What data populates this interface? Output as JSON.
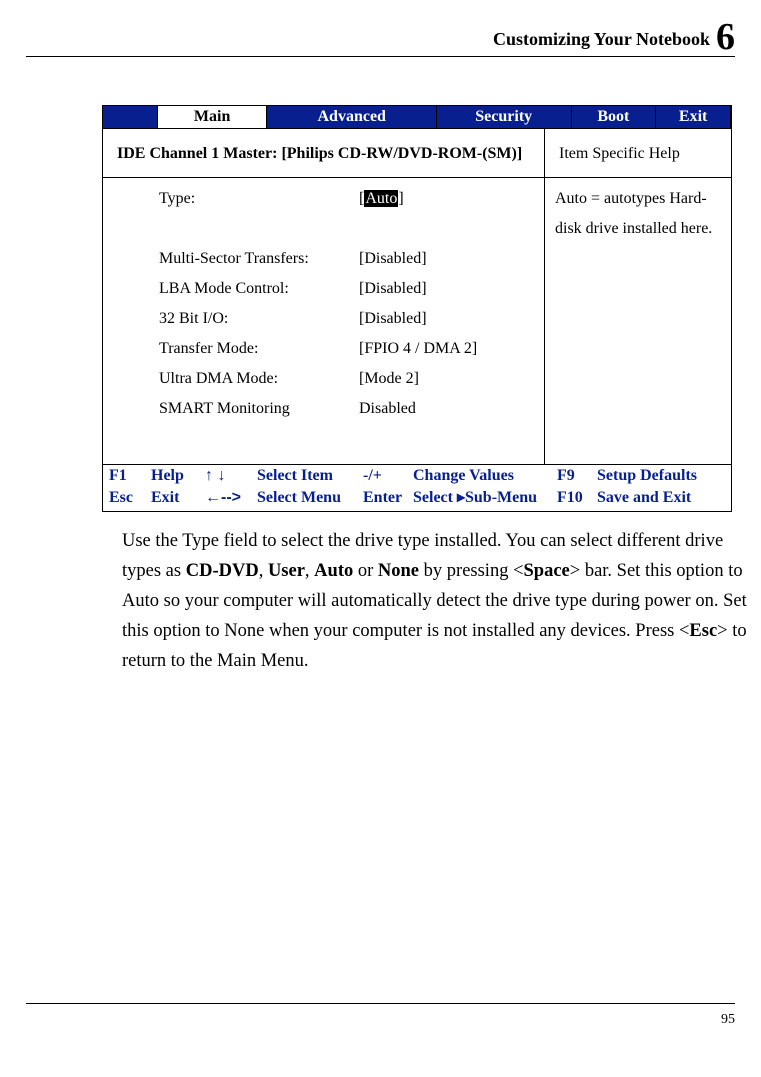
{
  "header": {
    "title": "Customizing Your Notebook",
    "chapter_number": "6"
  },
  "bios": {
    "tabs": {
      "main": "Main",
      "advanced": "Advanced",
      "security": "Security",
      "boot": "Boot",
      "exit": "Exit"
    },
    "panel_title": "IDE Channel 1 Master: [Philips CD-RW/DVD-ROM-(SM)]",
    "help_title": "Item Specific Help",
    "help_text": "Auto = autotypes Hard-disk drive installed here.",
    "settings": {
      "type": {
        "label": "Type:",
        "value": "Auto",
        "highlight": true,
        "bracket": true
      },
      "multi": {
        "label": "Multi-Sector Transfers:",
        "value": "[Disabled]",
        "highlight": false,
        "bracket": false
      },
      "lba": {
        "label": "LBA Mode Control:",
        "value": "[Disabled]",
        "highlight": false,
        "bracket": false
      },
      "bit32": {
        "label": "32 Bit I/O:",
        "value": "[Disabled]",
        "highlight": false,
        "bracket": false
      },
      "xfer": {
        "label": "Transfer Mode:",
        "value": "[FPIO 4 / DMA 2]",
        "highlight": false,
        "bracket": false
      },
      "udma": {
        "label": "Ultra DMA Mode:",
        "value": "[Mode 2]",
        "highlight": false,
        "bracket": false
      },
      "smart": {
        "label": "SMART Monitoring",
        "value": "Disabled",
        "highlight": false,
        "bracket": false
      }
    },
    "footer": {
      "f1": "F1",
      "help": "Help",
      "arrows_ud": "↑ ↓",
      "select_item": "Select Item",
      "minusplus": "-/+",
      "change_values": "Change Values",
      "f9": "F9",
      "setup_defaults": "Setup Defaults",
      "esc": "Esc",
      "exit": "Exit",
      "arrows_lr": "←-->",
      "select_menu": "Select Menu",
      "enter": "Enter",
      "select_sub": "Select ▸Sub-Menu",
      "f10": "F10",
      "save_exit": "Save and Exit"
    }
  },
  "paragraph": {
    "p1a": "Use the Type field to select the drive type installed. You can select different drive types as ",
    "cd": "CD-DVD",
    "c1": ", ",
    "user": "User",
    "c2": ", ",
    "auto": "Auto",
    "c3": " or ",
    "none": "None",
    "p1b": " by pressing <",
    "space": "Space",
    "p1c": "> bar. Set this option to Auto so your computer will automatically detect the drive type during power on. Set this option to None when your computer is not installed any devices. Press <",
    "escb": "Esc",
    "p1d": "> to return to the Main Menu."
  },
  "page_number": "95"
}
